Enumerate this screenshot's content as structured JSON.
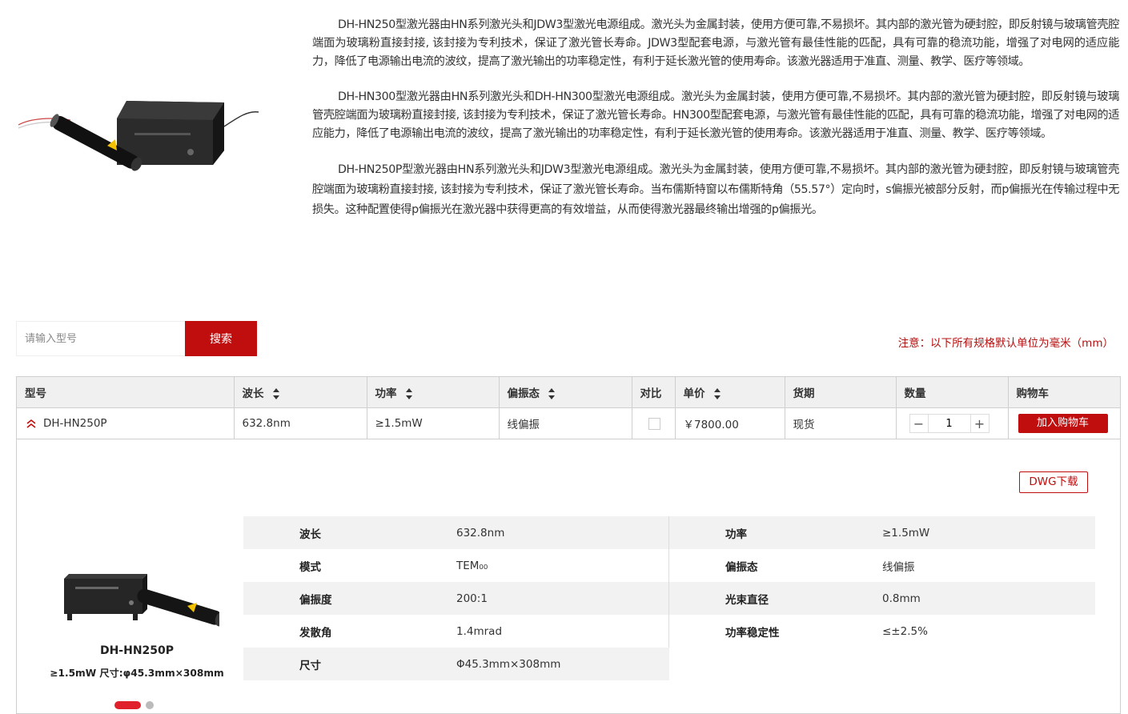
{
  "intro": {
    "paragraphs": [
      "DH-HN250型激光器由HN系列激光头和JDW3型激光电源组成。激光头为金属封装，使用方便可靠,不易损坏。其内部的激光管为硬封腔，即反射镜与玻璃管壳腔端面为玻璃粉直接封接, 该封接为专利技术，保证了激光管长寿命。JDW3型配套电源，与激光管有最佳性能的匹配，具有可靠的稳流功能，增强了对电网的适应能力，降低了电源输出电流的波纹，提高了激光输出的功率稳定性，有利于延长激光管的使用寿命。该激光器适用于准直、测量、教学、医疗等领域。",
      "DH-HN300型激光器由HN系列激光头和DH-HN300型激光电源组成。激光头为金属封装，使用方便可靠,不易损坏。其内部的激光管为硬封腔，即反射镜与玻璃管壳腔端面为玻璃粉直接封接, 该封接为专利技术，保证了激光管长寿命。HN300型配套电源，与激光管有最佳性能的匹配，具有可靠的稳流功能，增强了对电网的适应能力，降低了电源输出电流的波纹，提高了激光输出的功率稳定性，有利于延长激光管的使用寿命。该激光器适用于准直、测量、教学、医疗等领域。",
      "DH-HN250P型激光器由HN系列激光头和JDW3型激光电源组成。激光头为金属封装，使用方便可靠,不易损坏。其内部的激光管为硬封腔，即反射镜与玻璃管壳腔端面为玻璃粉直接封接, 该封接为专利技术，保证了激光管长寿命。当布儒斯特窗以布儒斯特角（55.57°）定向时，s偏振光被部分反射，而p偏振光在传输过程中无损失。这种配置使得p偏振光在激光器中获得更高的有效增益，从而使得激光器最终输出增强的p偏振光。"
    ]
  },
  "search": {
    "placeholder": "请输入型号",
    "button": "搜索"
  },
  "note": "注意：以下所有规格默认单位为毫米（mm）",
  "table": {
    "headers": {
      "model": "型号",
      "wavelength": "波长",
      "power": "功率",
      "polarization": "偏振态",
      "compare": "对比",
      "price": "单价",
      "stock": "货期",
      "quantity": "数量",
      "cart": "购物车"
    },
    "row": {
      "model": "DH-HN250P",
      "wavelength": "632.8nm",
      "power": "≥1.5mW",
      "polarization": "线偏振",
      "price": "￥7800.00",
      "stock": "现货",
      "quantity": "1",
      "add_to_cart": "加入购物车"
    }
  },
  "detail": {
    "dwg_button": "DWG下载",
    "product_name": "DH-HN250P",
    "product_spec": "≥1.5mW   尺寸:φ45.3mm×308mm",
    "attributes": {
      "wavelength": {
        "label": "波长",
        "value": "632.8nm"
      },
      "power": {
        "label": "功率",
        "value": "≥1.5mW"
      },
      "mode": {
        "label": "模式",
        "value": "TEM₀₀"
      },
      "polarization": {
        "label": "偏振态",
        "value": "线偏振"
      },
      "polarization_ratio": {
        "label": "偏振度",
        "value": "200:1"
      },
      "beam_diameter": {
        "label": "光束直径",
        "value": "0.8mm"
      },
      "divergence": {
        "label": "发散角",
        "value": "1.4mrad"
      },
      "power_stability": {
        "label": "功率稳定性",
        "value": "≤±2.5%"
      },
      "dimensions": {
        "label": "尺寸",
        "value": "Φ45.3mm×308mm"
      }
    }
  },
  "colors": {
    "accent": "#c00d0d",
    "header_bg": "#f0f0f0",
    "row_shade": "#f2f2f2",
    "dot_active": "#e0202a"
  }
}
